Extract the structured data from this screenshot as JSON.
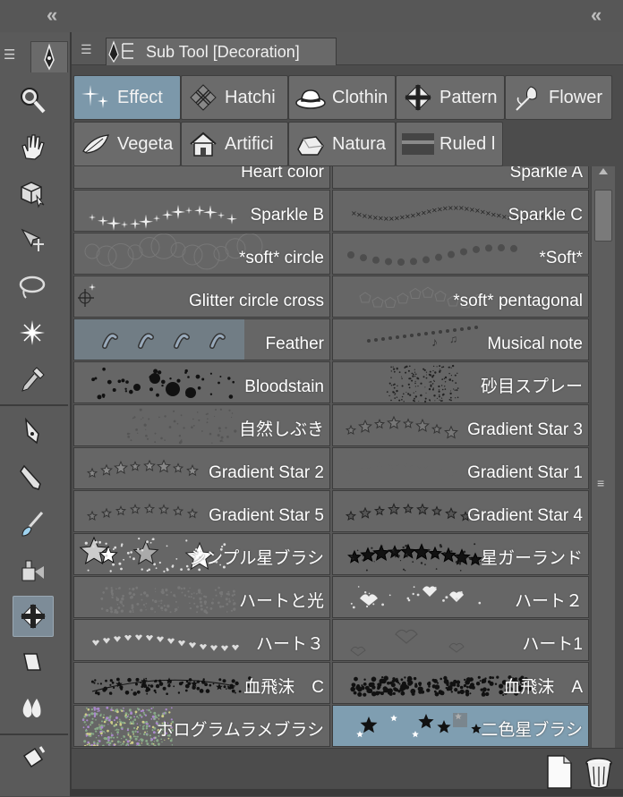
{
  "panel": {
    "title": "Sub Tool [Decoration]"
  },
  "categories": [
    {
      "label": "Effect",
      "icon": "sparkle-icon",
      "selected": true
    },
    {
      "label": "Hatchi",
      "icon": "hatching-icon",
      "selected": false
    },
    {
      "label": "Clothin",
      "icon": "hat-icon",
      "selected": false
    },
    {
      "label": "Pattern",
      "icon": "pattern-icon",
      "selected": false
    },
    {
      "label": "Flower",
      "icon": "flower-icon",
      "selected": false
    },
    {
      "label": "Vegeta",
      "icon": "leaf-icon",
      "selected": false
    },
    {
      "label": "Artifici",
      "icon": "house-icon",
      "selected": false
    },
    {
      "label": "Natura",
      "icon": "rock-icon",
      "selected": false
    },
    {
      "label": "Ruled l",
      "icon": "ruled-line-icon",
      "selected": false
    }
  ],
  "brushes": [
    {
      "left": "Heart color",
      "right": "Sparkle A"
    },
    {
      "left": "Sparkle B",
      "right": "Sparkle C"
    },
    {
      "left": "*soft* circle",
      "right": "*Soft*"
    },
    {
      "left": "Glitter circle cross",
      "right": "*soft* pentagonal"
    },
    {
      "left": "Feather",
      "right": "Musical note"
    },
    {
      "left": "Bloodstain",
      "right": "砂目スプレー"
    },
    {
      "left": "自然しぶき",
      "right": "Gradient Star 3"
    },
    {
      "left": "Gradient Star 2",
      "right": "Gradient Star 1"
    },
    {
      "left": "Gradient Star 5",
      "right": "Gradient Star 4"
    },
    {
      "left": "シンプル星ブラシ",
      "right": "星ガーランド"
    },
    {
      "left": "ハートと光",
      "right": "ハート２"
    },
    {
      "left": "ハート３",
      "right": "ハート1"
    },
    {
      "left": "血飛沫　C",
      "right": "血飛沫　A"
    },
    {
      "left": "ホログラムラメブラシ",
      "right": "二色星ブラシ"
    }
  ],
  "selected_brush": "二色星ブラシ",
  "tools": [
    "zoom-icon",
    "hand-icon",
    "cube-select-icon",
    "move-icon",
    "lasso-icon",
    "sparkle-wand-icon",
    "eyedropper-icon",
    "pen-icon",
    "pencil-icon",
    "brush-icon",
    "airbrush-icon",
    "decoration-icon",
    "eraser-icon",
    "blend-icon",
    "fill-icon"
  ],
  "colors": {
    "selected": "#7c98aa",
    "panel_bg": "#4c4c4c"
  }
}
